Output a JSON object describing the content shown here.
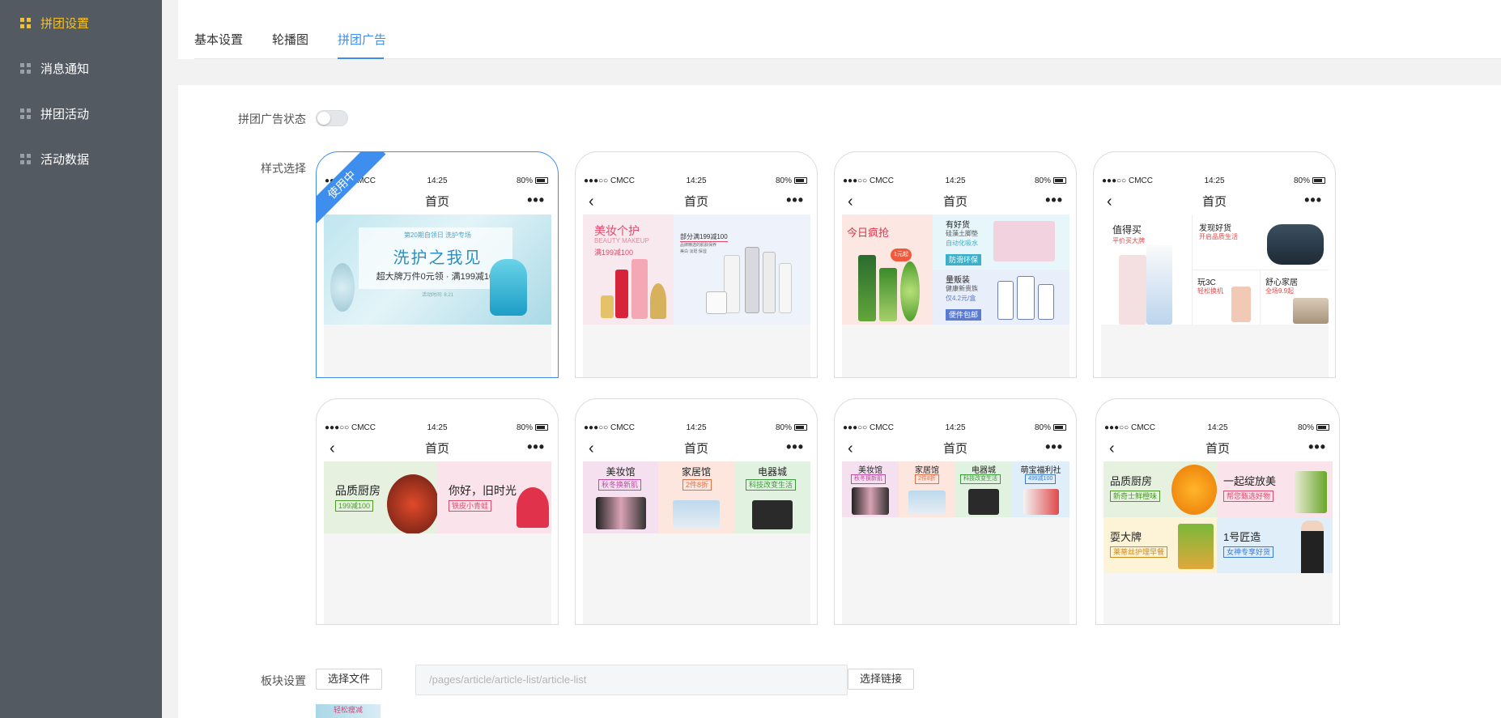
{
  "sidebar": {
    "items": [
      {
        "label": "拼团设置",
        "active": true
      },
      {
        "label": "消息通知",
        "active": false
      },
      {
        "label": "拼团活动",
        "active": false
      },
      {
        "label": "活动数据",
        "active": false
      }
    ]
  },
  "tabs": [
    {
      "label": "基本设置"
    },
    {
      "label": "轮播图"
    },
    {
      "label": "拼团广告",
      "active": true
    }
  ],
  "form": {
    "status_label": "拼团广告状态",
    "style_label": "样式选择",
    "block_label": "板块设置",
    "toggle_on": false,
    "choose_file": "选择文件",
    "link_placeholder": "/pages/article/article-list/article-list",
    "choose_link": "选择链接",
    "thumb_text": "轻松瘦减"
  },
  "phone": {
    "carrier": "●●●○○ CMCC",
    "time": "14:25",
    "battery": "80%",
    "title": "首页",
    "back": "‹",
    "more": "•••",
    "selected_badge": "使用中"
  },
  "styles": {
    "s1": {
      "small": "第20期自领日 洗护专场",
      "big": "洗护之我见",
      "sub": "超大牌万件0元领 · 满199减100",
      "note": "活动时间: 8.21"
    },
    "s2": {
      "title": "美妆个护",
      "en": "BEAUTY MAKEUP",
      "promo": "满199减100",
      "right": "部分满199减100",
      "right_sub": "品牌精选的肌肤保养",
      "right_tags": "美白   淡斑   保湿"
    },
    "s3": {
      "left": "今日疯抢",
      "badge": "1元起",
      "t1": "有好货",
      "t1a": "硅藻土脚垫",
      "t1b": "自动化吸水",
      "t1c": "防滑环保",
      "t2": "量贩装",
      "t2a": "健康新贵族",
      "t2b": "仅4.2元/盒",
      "t2c": "便件包邮"
    },
    "s4": {
      "a": "值得买",
      "a_sub": "平价买大牌",
      "b": "发现好货",
      "b_sub": "开启品质生活",
      "c": "玩3C",
      "c_sub": "轻松换机",
      "d": "舒心家居",
      "d_sub": "全场9.9起"
    },
    "s5": {
      "a": "品质厨房",
      "a_tag": "199减100",
      "b": "你好，旧时光",
      "b_tag": "铁皮小青蛙"
    },
    "s6": {
      "a": "美妆馆",
      "a_tag": "秋冬换新肌",
      "b": "家居馆",
      "b_tag": "2件8折",
      "c": "电器城",
      "c_tag": "科技改变生活"
    },
    "s7": {
      "a": "美妆馆",
      "a_tag": "秋冬换新肌",
      "b": "家居馆",
      "b_tag": "2件8折",
      "c": "电器城",
      "c_tag": "科技改变生活",
      "d": "萌宝福利社",
      "d_tag": "499减100"
    },
    "s8": {
      "a": "品质厨房",
      "a_tag": "新奇士鲜橙味",
      "b": "一起绽放美",
      "b_tag": "帮您甄选好物",
      "c": "耍大牌",
      "c_tag": "莱蒂丝护理早餐",
      "d": "1号匠造",
      "d_tag": "女神专享好货"
    }
  }
}
